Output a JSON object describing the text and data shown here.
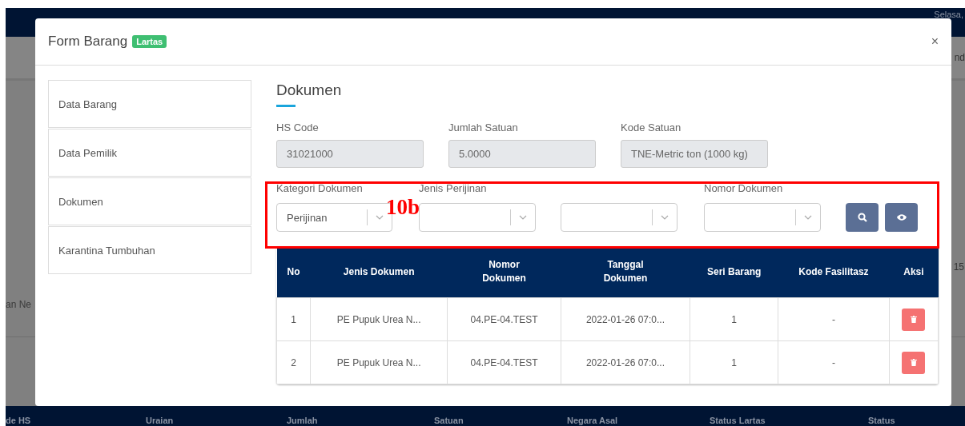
{
  "backdrop": {
    "date": "Selasa,",
    "side_text": "nd",
    "page_count": "15",
    "row_text": "an Ne",
    "columns": [
      "de HS",
      "Uraian",
      "Jumlah",
      "Satuan",
      "Negara Asal",
      "Status Lartas",
      "Status"
    ]
  },
  "modal": {
    "title": "Form Barang",
    "badge": "Lartas",
    "close": "×"
  },
  "sidebar": {
    "items": [
      {
        "label": "Data Barang"
      },
      {
        "label": "Data Pemilik"
      },
      {
        "label": "Dokumen"
      },
      {
        "label": "Karantina Tumbuhan"
      }
    ]
  },
  "section": {
    "title": "Dokumen"
  },
  "fields": [
    {
      "label": "HS Code",
      "value": "31021000",
      "disabled": true
    },
    {
      "label": "Jumlah Satuan",
      "value": "5.0000",
      "disabled": true
    },
    {
      "label": "Kode Satuan",
      "value": "TNE-Metric ton (1000 kg)",
      "disabled": true
    }
  ],
  "filters": [
    {
      "kind": "select",
      "label": "Kategori Dokumen",
      "value": "Perijinan"
    },
    {
      "kind": "select",
      "label": "Jenis Perijinan"
    },
    {
      "kind": "select"
    },
    {
      "kind": "select",
      "label": "Nomor Dokumen"
    }
  ],
  "buttons": [
    {
      "kind": "search"
    },
    {
      "kind": "view"
    }
  ],
  "annotation": {
    "label": "10b"
  },
  "table": {
    "columns": [
      "No",
      "Jenis Dokumen",
      "Nomor\nDokumen",
      "Tanggal\nDokumen",
      "Seri Barang",
      "Kode Fasilitasz",
      "Aksi"
    ],
    "rows": [
      {
        "cells": [
          "1",
          "PE Pupuk Urea N...",
          "04.PE-04.TEST",
          "2022-01-26 07:0...",
          "1",
          "-"
        ],
        "actions": [
          {
            "kind": "delete"
          }
        ]
      },
      {
        "cells": [
          "2",
          "PE Pupuk Urea N...",
          "04.PE-04.TEST",
          "2022-01-26 07:0...",
          "1",
          "-"
        ],
        "actions": [
          {
            "kind": "delete"
          }
        ]
      }
    ]
  }
}
